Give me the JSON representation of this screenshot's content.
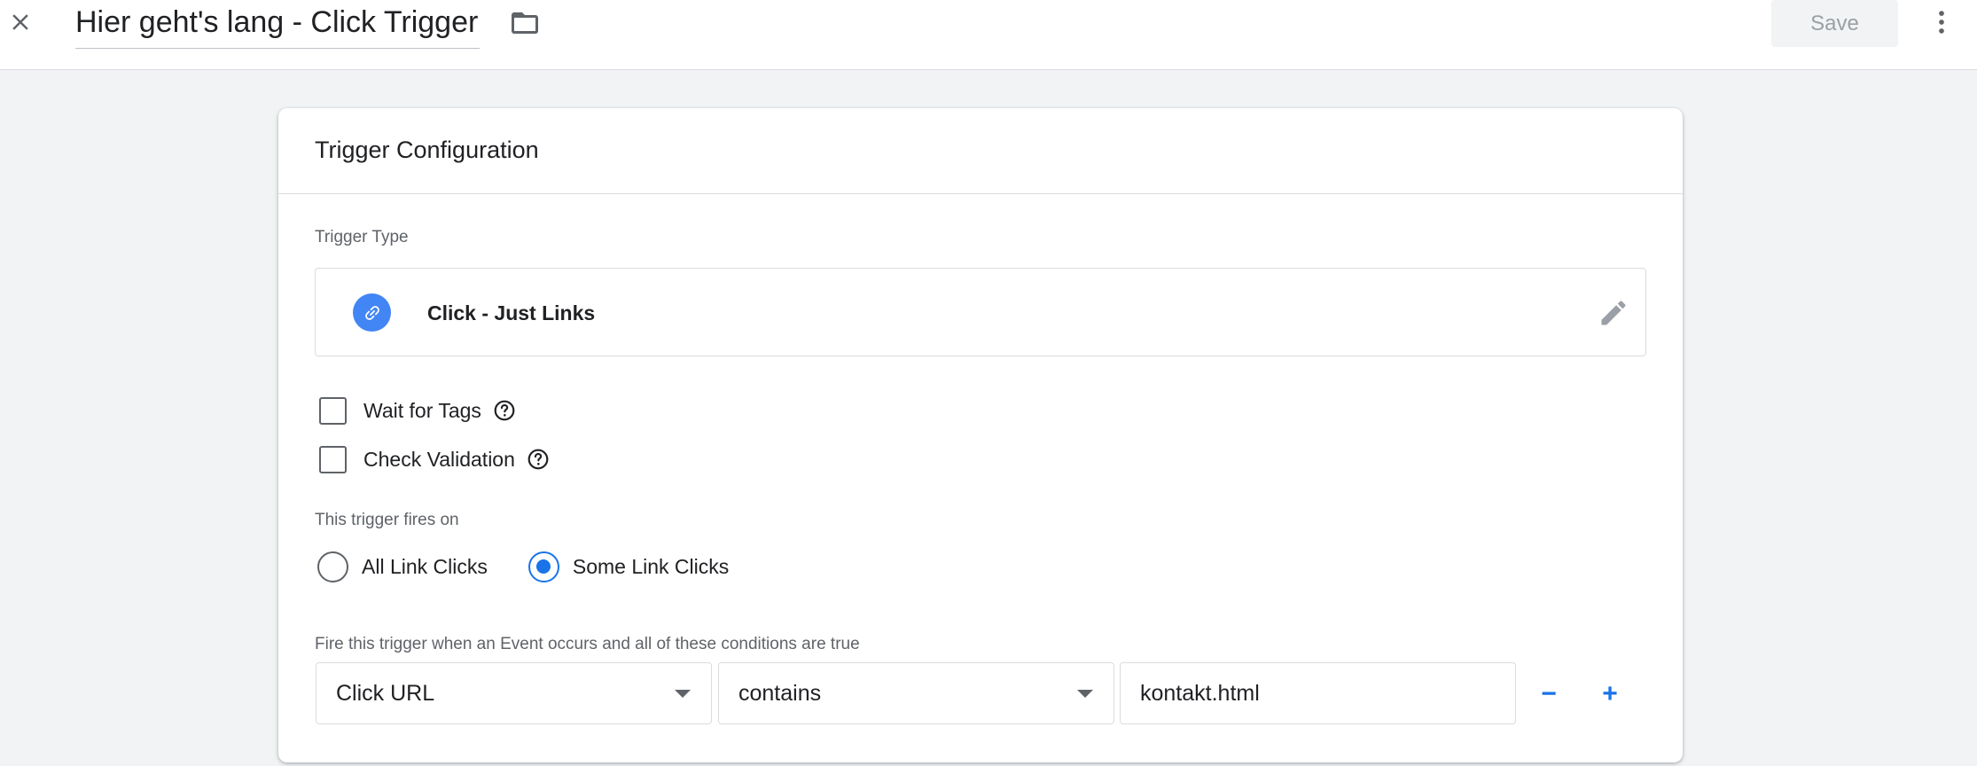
{
  "header": {
    "title": "Hier geht's lang - Click Trigger",
    "save_label": "Save"
  },
  "card": {
    "title": "Trigger Configuration",
    "trigger_type_label": "Trigger Type",
    "trigger_type_name": "Click - Just Links",
    "options": [
      {
        "label": "Wait for Tags",
        "checked": false
      },
      {
        "label": "Check Validation",
        "checked": false
      }
    ],
    "fires_on_label": "This trigger fires on",
    "fires_on_options": [
      {
        "label": "All Link Clicks",
        "selected": false
      },
      {
        "label": "Some Link Clicks",
        "selected": true
      }
    ],
    "condition_label": "Fire this trigger when an Event occurs and all of these conditions are true",
    "condition": {
      "variable": "Click URL",
      "operator": "contains",
      "value": "kontakt.html"
    },
    "remove_label": "−",
    "add_label": "+"
  },
  "colors": {
    "accent": "#1a73e8",
    "link_badge": "#4285f4",
    "background": "#f1f3f4"
  },
  "icons": [
    "close-icon",
    "folder-icon",
    "more-vert-icon",
    "link-icon",
    "pencil-icon",
    "help-icon"
  ]
}
